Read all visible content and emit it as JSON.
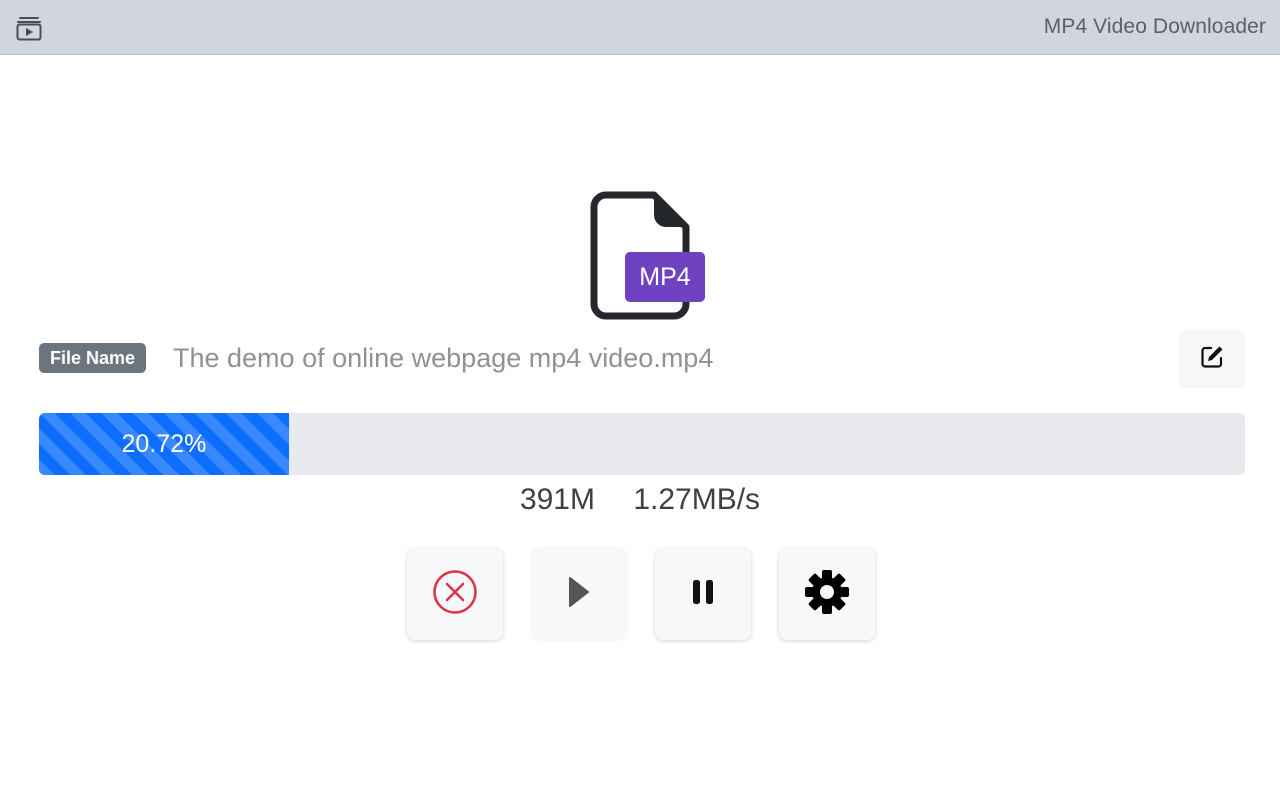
{
  "header": {
    "app_icon": "video-library-icon",
    "title": "MP4 Video Downloader"
  },
  "file": {
    "icon": "file-icon",
    "badge": "MP4",
    "badge_color": "#6f42c1",
    "name_label": "File Name",
    "name": "The demo of online webpage mp4 video.mp4",
    "edit_icon": "edit-icon"
  },
  "progress": {
    "percent": 20.72,
    "label": "20.72%",
    "color": "#0d6efd"
  },
  "stats": {
    "size": "391M",
    "speed": "1.27MB/s"
  },
  "controls": [
    {
      "name": "cancel",
      "icon": "cancel-circle-icon",
      "color": "#dc3545"
    },
    {
      "name": "play",
      "icon": "play-icon",
      "color": "#555555"
    },
    {
      "name": "pause",
      "icon": "pause-icon",
      "color": "#111111"
    },
    {
      "name": "settings",
      "icon": "gear-icon",
      "color": "#000000"
    }
  ]
}
